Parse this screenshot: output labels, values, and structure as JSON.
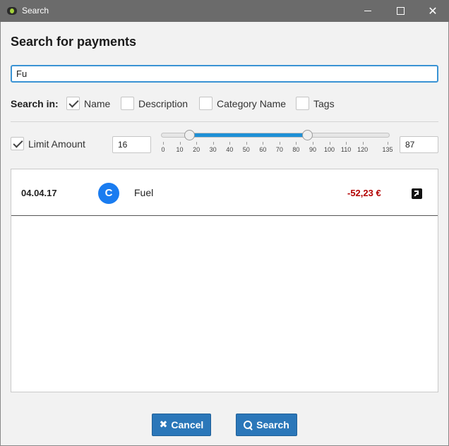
{
  "window": {
    "title": "Search"
  },
  "dialog": {
    "heading": "Search for payments",
    "search": {
      "value": "Fu",
      "placeholder": ""
    },
    "search_in": {
      "label": "Search in:",
      "options": [
        {
          "label": "Name",
          "checked": true
        },
        {
          "label": "Description",
          "checked": false
        },
        {
          "label": "Category Name",
          "checked": false
        },
        {
          "label": "Tags",
          "checked": false
        }
      ]
    },
    "limit_amount": {
      "label": "Limit Amount",
      "checked": true,
      "min_value": "16",
      "max_value": "87",
      "slider": {
        "range_min": 0,
        "range_max": 135,
        "low": 16,
        "high": 87,
        "ticks": [
          "0",
          "10",
          "20",
          "30",
          "40",
          "50",
          "60",
          "70",
          "80",
          "90",
          "100",
          "110",
          "120",
          "135"
        ]
      }
    },
    "results": [
      {
        "date": "04.04.17",
        "avatar_letter": "C",
        "avatar_color": "#1a7cf0",
        "name": "Fuel",
        "amount": "-52,23 €",
        "amount_color": "#b30000"
      }
    ],
    "buttons": {
      "cancel": "Cancel",
      "search": "Search"
    }
  },
  "colors": {
    "accent": "#2b77b9",
    "slider_fill": "#1e90d6",
    "titlebar": "#6b6b6b"
  }
}
